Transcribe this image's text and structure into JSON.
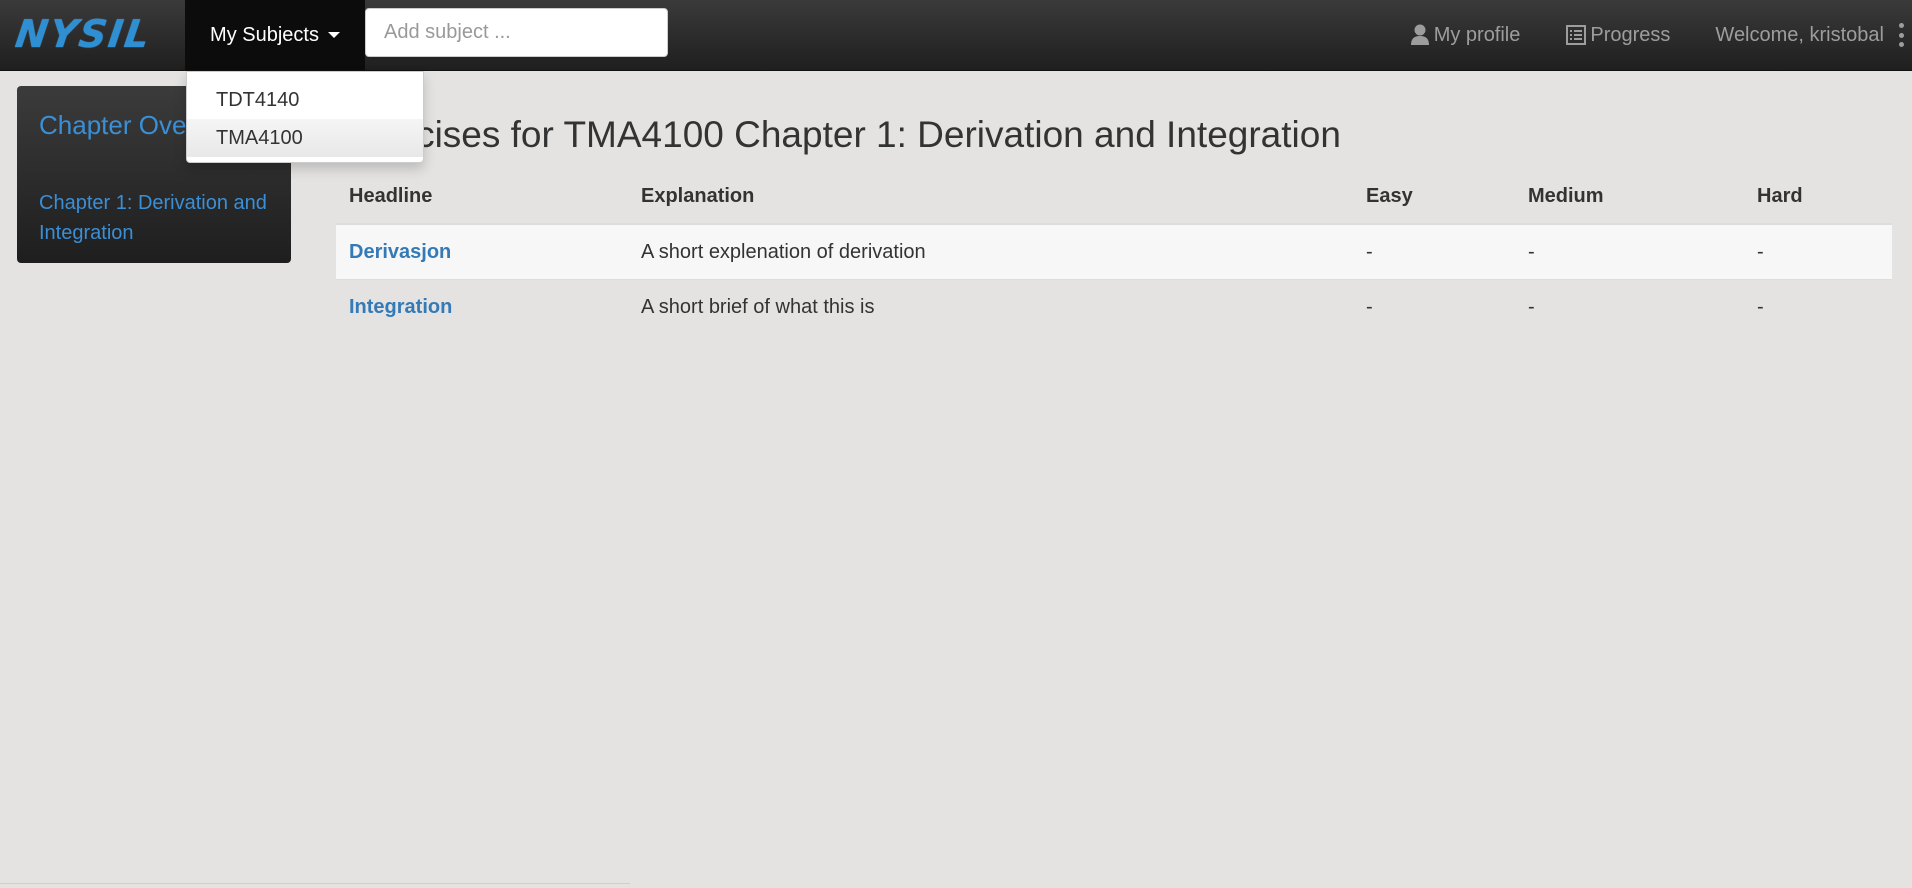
{
  "navbar": {
    "brand": "NYSIL",
    "subjects_label": "My Subjects",
    "search_placeholder": "Add subject ...",
    "profile_label": "My profile",
    "progress_label": "Progress",
    "welcome_label": "Welcome, kristobal",
    "icons": [
      "user-icon",
      "list-icon",
      "more-vertical-icon",
      "caret-down-icon"
    ],
    "brand_color": "#2f8fd3"
  },
  "dropdown": {
    "items": [
      {
        "label": "TDT4140",
        "active": false
      },
      {
        "label": "TMA4100",
        "active": true
      }
    ]
  },
  "sidebar": {
    "title": "Chapter Overview",
    "items": [
      {
        "label": "Chapter 1: Derivation and Integration"
      }
    ]
  },
  "main": {
    "title": "Exercises for TMA4100 Chapter 1: Derivation and Integration",
    "table": {
      "headers": [
        "Headline",
        "Explanation",
        "Easy",
        "Medium",
        "Hard"
      ],
      "rows": [
        {
          "headline": "Derivasjon",
          "explanation": "A short explenation of derivation",
          "easy": "-",
          "medium": "-",
          "hard": "-"
        },
        {
          "headline": "Integration",
          "explanation": "A short brief of what this is",
          "easy": "-",
          "medium": "-",
          "hard": "-"
        }
      ]
    },
    "link_color": "#337ab7"
  }
}
